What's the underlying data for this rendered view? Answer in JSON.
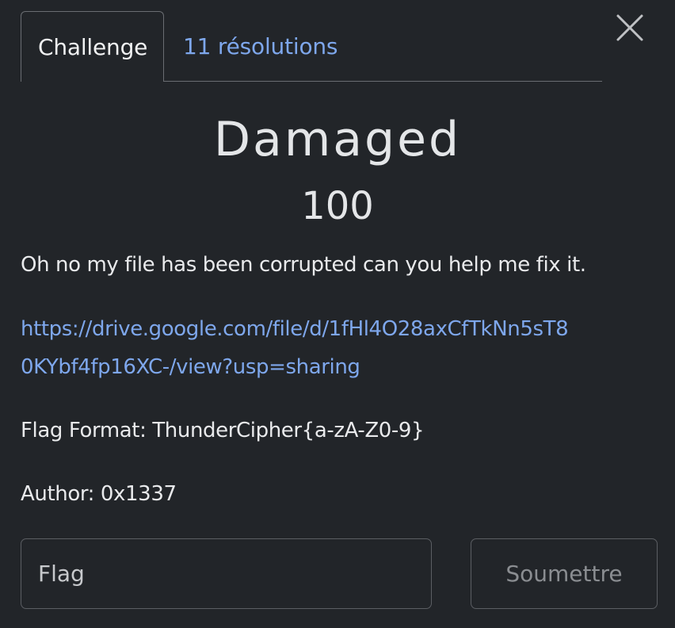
{
  "tabs": {
    "challenge_label": "Challenge",
    "solves_label": "11 résolutions"
  },
  "icons": {
    "close": "close-icon"
  },
  "challenge": {
    "name": "Damaged",
    "points": "100",
    "description": "Oh no my file has been corrupted can you help me fix it.",
    "link_line1": "https://drive.google.com/file/d/1fHl4O28axCfTkNn5sT8",
    "link_line2": "0KYbf4fp16XC-/view?usp=sharing",
    "flag_format": "Flag Format: ThunderCipher{a-zA-Z0-9}",
    "author": "Author: 0x1337"
  },
  "form": {
    "flag_placeholder": "Flag",
    "submit_label": "Soumettre"
  },
  "colors": {
    "background": "#222529",
    "link": "#7ea7ec",
    "text": "#e9eaec",
    "border": "#5b5e63"
  }
}
